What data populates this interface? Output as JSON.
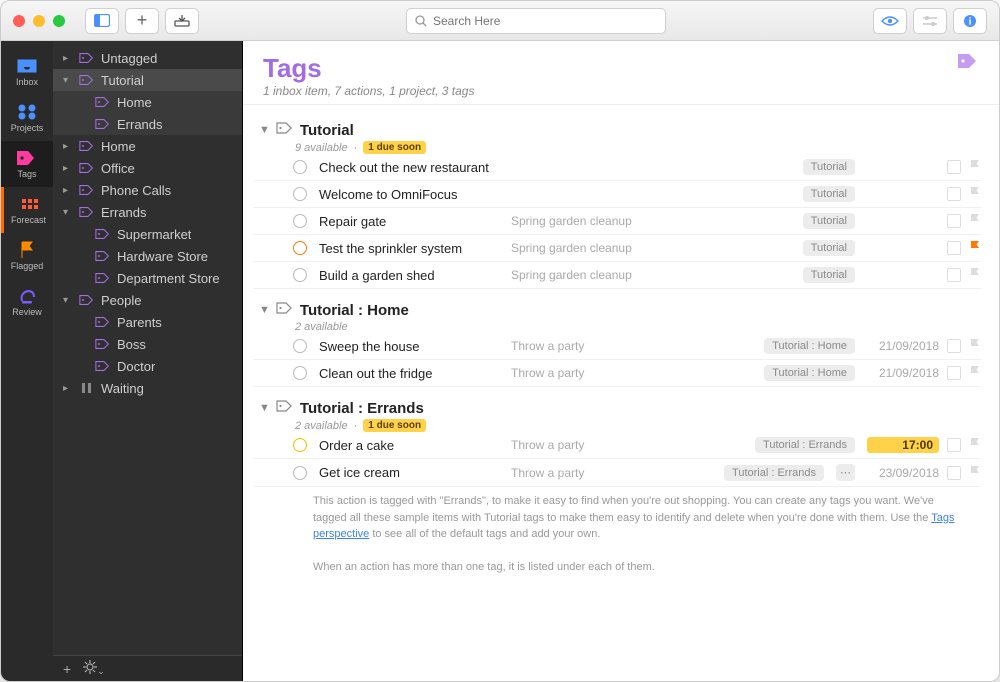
{
  "search": {
    "placeholder": "Search Here"
  },
  "rail": [
    {
      "id": "inbox",
      "label": "Inbox",
      "color": "#4a90ff"
    },
    {
      "id": "projects",
      "label": "Projects",
      "color": "#4a90ff"
    },
    {
      "id": "tags",
      "label": "Tags",
      "color": "#ff3aa0"
    },
    {
      "id": "forecast",
      "label": "Forecast",
      "color": "#ff5a3a"
    },
    {
      "id": "flagged",
      "label": "Flagged",
      "color": "#ff8a00"
    },
    {
      "id": "review",
      "label": "Review",
      "color": "#7a5cff"
    }
  ],
  "sidebar": {
    "items": [
      {
        "label": "Untagged",
        "kind": "root"
      },
      {
        "label": "Tutorial",
        "kind": "root",
        "selected": true,
        "expanded": true
      },
      {
        "label": "Home",
        "kind": "child",
        "child": true,
        "subselected": true
      },
      {
        "label": "Errands",
        "kind": "child",
        "child": true,
        "subselected": true
      },
      {
        "label": "Home",
        "kind": "root"
      },
      {
        "label": "Office",
        "kind": "root"
      },
      {
        "label": "Phone Calls",
        "kind": "root"
      },
      {
        "label": "Errands",
        "kind": "root",
        "expanded": true
      },
      {
        "label": "Supermarket",
        "kind": "child",
        "child": true
      },
      {
        "label": "Hardware Store",
        "kind": "child",
        "child": true
      },
      {
        "label": "Department Store",
        "kind": "child",
        "child": true
      },
      {
        "label": "People",
        "kind": "root",
        "expanded": true
      },
      {
        "label": "Parents",
        "kind": "child",
        "child": true
      },
      {
        "label": "Boss",
        "kind": "child",
        "child": true
      },
      {
        "label": "Doctor",
        "kind": "child",
        "child": true
      },
      {
        "label": "Waiting",
        "kind": "root",
        "paused": true
      }
    ]
  },
  "header": {
    "title": "Tags",
    "subtitle": "1 inbox item, 7 actions, 1 project, 3 tags"
  },
  "groups": [
    {
      "title": "Tutorial",
      "sub": "9 available",
      "due_soon": "1 due soon",
      "actions": [
        {
          "title": "Check out the new restaurant",
          "proj": "",
          "tag": "Tutorial",
          "note": true
        },
        {
          "title": "Welcome to OmniFocus",
          "proj": "",
          "tag": "Tutorial",
          "note": true
        },
        {
          "title": "Repair gate",
          "proj": "Spring garden cleanup",
          "tag": "Tutorial",
          "note": true
        },
        {
          "title": "Test the sprinkler system",
          "proj": "Spring garden cleanup",
          "tag": "Tutorial",
          "note": true,
          "circle": "orange",
          "flagged": true
        },
        {
          "title": "Build a garden shed",
          "proj": "Spring garden cleanup",
          "tag": "Tutorial",
          "note": true
        }
      ]
    },
    {
      "title": "Tutorial : Home",
      "sub": "2 available",
      "actions": [
        {
          "title": "Sweep the house",
          "proj": "Throw a party",
          "tag": "Tutorial : Home",
          "date": "21/09/2018",
          "note": true
        },
        {
          "title": "Clean out the fridge",
          "proj": "Throw a party",
          "tag": "Tutorial : Home",
          "date": "21/09/2018",
          "note": true
        }
      ]
    },
    {
      "title": "Tutorial : Errands",
      "sub": "2 available",
      "due_soon": "1 due soon",
      "actions": [
        {
          "title": "Order a cake",
          "proj": "Throw a party",
          "tag": "Tutorial : Errands",
          "date": "17:00",
          "due": true,
          "note": true,
          "circle": "yellow"
        },
        {
          "title": "Get ice cream",
          "proj": "Throw a party",
          "tag": "Tutorial : Errands",
          "date": "23/09/2018",
          "note": true,
          "multi": true
        }
      ]
    }
  ],
  "description": {
    "line1": "This action is tagged with \"Errands\", to make it easy to find when you're out shopping. You can create any tags you want. We've tagged all these sample items with Tutorial tags to make them easy to identify and delete when you're done with them. Use the ",
    "link": "Tags perspective",
    "line1b": " to see all of the default tags and add your own.",
    "line2": "When an action has more than one tag, it is listed under each of them."
  }
}
